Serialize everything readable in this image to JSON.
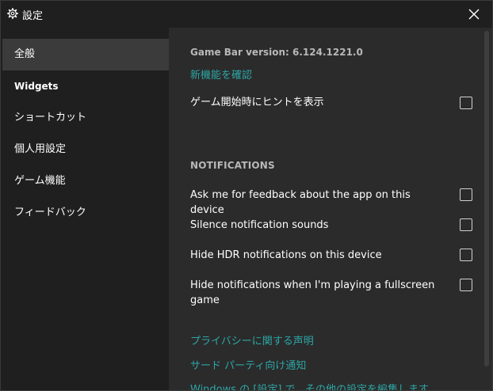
{
  "window": {
    "title": "設定"
  },
  "sidebar": {
    "items": [
      {
        "label": "全般",
        "selected": true
      },
      {
        "label": "Widgets",
        "selected": false
      },
      {
        "label": "ショートカット",
        "selected": false
      },
      {
        "label": "個人用設定",
        "selected": false
      },
      {
        "label": "ゲーム機能",
        "selected": false
      },
      {
        "label": "フィードバック",
        "selected": false
      }
    ]
  },
  "general": {
    "version_text": "Game Bar version: 6.124.1221.0",
    "whats_new_link": "新機能を確認",
    "show_tips_label": "ゲーム開始時にヒントを表示",
    "show_tips_checked": false
  },
  "notifications": {
    "header": "NOTIFICATIONS",
    "options": [
      {
        "label": "Ask me for feedback about the app on this device",
        "checked": false
      },
      {
        "label": "Silence notification sounds",
        "checked": false
      },
      {
        "label": "Hide HDR notifications on this device",
        "checked": false
      },
      {
        "label": "Hide notifications when I'm playing a fullscreen game",
        "checked": false
      }
    ]
  },
  "footer_links": {
    "privacy": "プライバシーに関する声明",
    "third_party": "サード パーティ向け通知",
    "windows_settings": "Windows の [設定] で、その他の設定を編集します"
  },
  "colors": {
    "accent_link": "#2da6a6",
    "selected_nav": "#3b3b3b",
    "content_bg": "#2b2b2b"
  }
}
